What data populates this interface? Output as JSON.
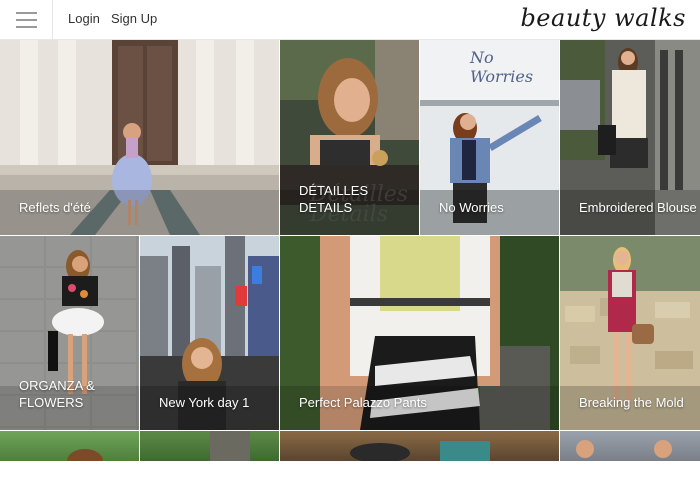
{
  "header": {
    "menu_icon": "hamburger-icon",
    "links": [
      "Login",
      "Sign Up"
    ],
    "logo": "beauty walks"
  },
  "tiles": [
    {
      "caption": "Reflets d'été"
    },
    {
      "caption": "DÉTAILLES DETAILS",
      "overlay": "Détailles Details"
    },
    {
      "caption": "No Worries",
      "overlay": "No Worries"
    },
    {
      "caption": "Embroidered Blouse"
    },
    {
      "caption": "ORGANZA & FLOWERS"
    },
    {
      "caption": "New York day 1"
    },
    {
      "caption": "Perfect Palazzo Pants"
    },
    {
      "caption": "Breaking the Mold"
    }
  ],
  "colors": {
    "caption_text": "#ffffff",
    "header_border": "#e6e6e6",
    "link_text": "#333333"
  }
}
